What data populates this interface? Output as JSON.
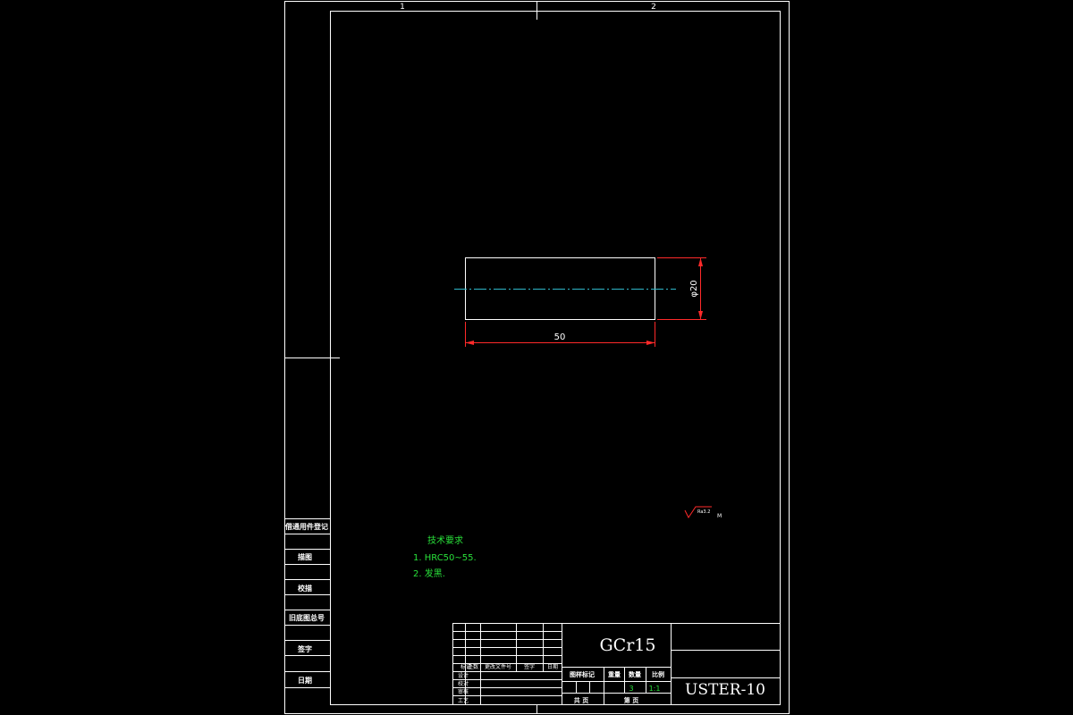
{
  "zones": [
    "1",
    "2"
  ],
  "dimensions": {
    "length": "50",
    "diameter": "φ20"
  },
  "roughness": {
    "label": "Ra3.2",
    "extra": "M"
  },
  "side_labels": [
    "借通用件登记",
    "描图",
    "校描",
    "旧底图总号",
    "签字",
    "日期"
  ],
  "tech_requirements": {
    "title": "技术要求",
    "items": [
      "1. HRC50~55.",
      "2. 发黑."
    ]
  },
  "title_block": {
    "material": "GCr15",
    "drawing_number": "USTER-10",
    "header_labels": [
      "标记",
      "处数",
      "更改文件号",
      "签字",
      "日期"
    ],
    "row_labels": [
      "设计",
      "校对",
      "审核",
      "工艺"
    ],
    "stage_labels": [
      "图样标记",
      "重量",
      "数量",
      "比例"
    ],
    "quantity": "3",
    "scale": "1:1",
    "sheet_total_label": "共   页",
    "sheet_index_label": "第   页"
  }
}
